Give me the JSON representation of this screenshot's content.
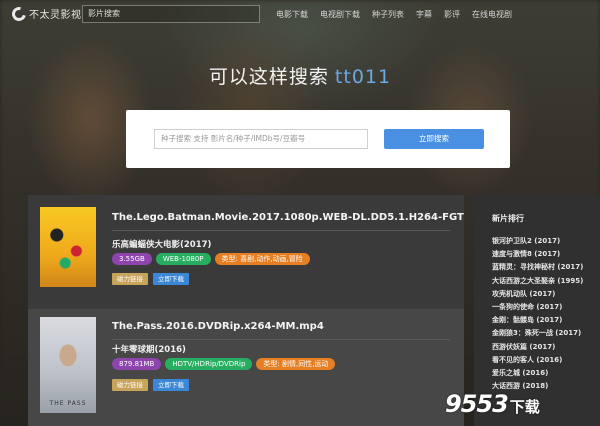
{
  "app": {
    "logo_text": "不太灵影视",
    "search_placeholder": "影片搜索"
  },
  "nav": {
    "links": [
      "电影下载",
      "电视剧下载",
      "种子列表",
      "字幕",
      "影评",
      "在线电视剧"
    ]
  },
  "hero": {
    "title": "可以这样搜索",
    "example": "tt011"
  },
  "search": {
    "placeholder": "种子搜索 支持 影片名/种子/IMDb号/豆瓣号",
    "button": "立即搜索"
  },
  "results": [
    {
      "title": "The.Lego.Batman.Movie.2017.1080p.WEB-DL.DD5.1.H264-FGT",
      "subtitle": "乐高蝙蝠侠大电影(2017)",
      "poster_icon": "lego-batman-poster",
      "tags": [
        {
          "text": "3.55GB",
          "color": "#8e44ad"
        },
        {
          "text": "WEB-1080P",
          "color": "#27ae60"
        },
        {
          "text": "类型: 喜剧,动作,动画,冒险",
          "color": "#e67e22"
        }
      ],
      "actions": [
        {
          "text": "磁力链接",
          "color": "#c8a35a"
        },
        {
          "text": "立即下载",
          "color": "#3a87d6"
        }
      ]
    },
    {
      "title": "The.Pass.2016.DVDRip.x264-MM.mp4",
      "subtitle": "十年零球期(2016)",
      "poster_icon": "the-pass-poster",
      "poster_label": "THE PASS",
      "tags": [
        {
          "text": "879.81MB",
          "color": "#8e44ad"
        },
        {
          "text": "HDTV/HDRip/DVDRip",
          "color": "#27ae60"
        },
        {
          "text": "类型: 剧情,同性,运动",
          "color": "#e67e22"
        }
      ],
      "actions": [
        {
          "text": "磁力链接",
          "color": "#c8a35a"
        },
        {
          "text": "立即下载",
          "color": "#3a87d6"
        }
      ]
    }
  ],
  "sidebar": {
    "title": "新片排行",
    "items": [
      "银河护卫队2 (2017)",
      "速度与激情8 (2017)",
      "蓝精灵：寻找神秘村 (2017)",
      "大话西游之大圣娶亲 (1995)",
      "攻壳机动队 (2017)",
      "一条狗的使命 (2017)",
      "金刚：骷髅岛 (2017)",
      "金刚狼3：殊死一战 (2017)",
      "西游伏妖篇 (2017)",
      "看不见的客人 (2016)",
      "爱乐之城 (2016)",
      "大话西游 (2018)"
    ]
  },
  "watermark": {
    "number": "9553",
    "text": "下载"
  }
}
